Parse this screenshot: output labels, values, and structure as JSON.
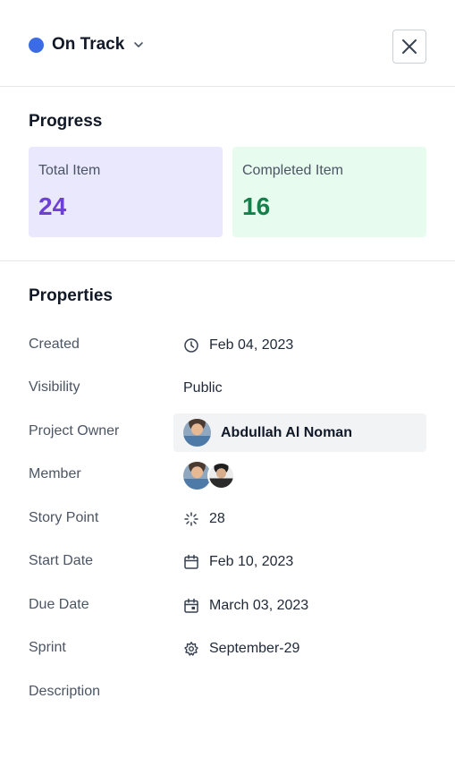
{
  "header": {
    "status_label": "On Track",
    "status_color": "#3b6ce6",
    "status_icon": "chevron-down-icon",
    "close_icon": "close-icon"
  },
  "progress": {
    "title": "Progress",
    "total": {
      "label": "Total Item",
      "value": "24",
      "color": "#6d3fd6",
      "background": "#e9e8fd"
    },
    "completed": {
      "label": "Completed Item",
      "value": "16",
      "color": "#16804a",
      "background": "#e8fbef"
    }
  },
  "properties": {
    "title": "Properties",
    "created": {
      "label": "Created",
      "value": "Feb 04, 2023",
      "icon": "clock-icon"
    },
    "visibility": {
      "label": "Visibility",
      "value": "Public"
    },
    "owner": {
      "label": "Project Owner",
      "value": "Abdullah Al Noman",
      "icon": "avatar"
    },
    "member": {
      "label": "Member",
      "icons": [
        "avatar",
        "avatar"
      ]
    },
    "story_point": {
      "label": "Story Point",
      "value": "28",
      "icon": "loader-icon"
    },
    "start_date": {
      "label": "Start Date",
      "value": "Feb 10, 2023",
      "icon": "calendar-icon"
    },
    "due_date": {
      "label": "Due Date",
      "value": "March 03, 2023",
      "icon": "calendar-event-icon"
    },
    "sprint": {
      "label": "Sprint",
      "value": "September-29",
      "icon": "sprint-icon"
    },
    "description": {
      "label": "Description"
    }
  }
}
